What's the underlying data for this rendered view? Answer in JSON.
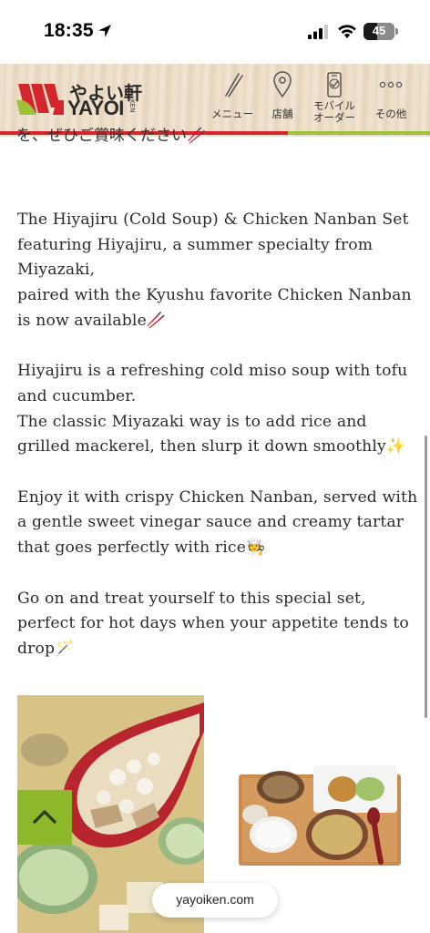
{
  "status_bar": {
    "time": "18:35",
    "battery": "45",
    "battery_level": 0.45,
    "icons": [
      "location-arrow-icon",
      "cellular-signal-icon",
      "wifi-icon",
      "battery-icon"
    ]
  },
  "header": {
    "logo_jp": "やよい軒",
    "logo_en": "YAYOI",
    "logo_ken": "KEN",
    "accent_red": "#d3262d",
    "accent_green": "#9dc238",
    "nav": [
      {
        "label": "メニュー",
        "icon": "chopsticks-icon"
      },
      {
        "label": "店舗",
        "icon": "map-pin-icon"
      },
      {
        "label": "モバイル\nオーダー",
        "icon": "mobile-phone-icon"
      },
      {
        "label": "その他",
        "icon": "more-dots-icon"
      }
    ]
  },
  "clipped_text": "を、ぜひご賞味ください🥢",
  "article": {
    "paragraphs": [
      "The Hiyajiru (Cold Soup) & Chicken Nanban Set featuring Hiyajiru, a summer specialty from Miyazaki,\npaired with the Kyushu favorite Chicken Nanban is now available🥢",
      "Hiyajiru is a refreshing cold miso soup with tofu and cucumber.\nThe classic Miyazaki way is to add rice and grilled mackerel, then slurp it down smoothly✨",
      "Enjoy it with crispy Chicken Nanban, served with a gentle sweet vinegar sauce and creamy tartar that goes perfectly with rice🧑‍🍳",
      "Go on and treat yourself to this special set, perfect for hot days when your appetite tends to drop🪄"
    ]
  },
  "overlay": {
    "scroll_top_icon": "chevron-up-icon",
    "scroll_top_color": "#8db82c",
    "domain": "yayoiken.com"
  }
}
